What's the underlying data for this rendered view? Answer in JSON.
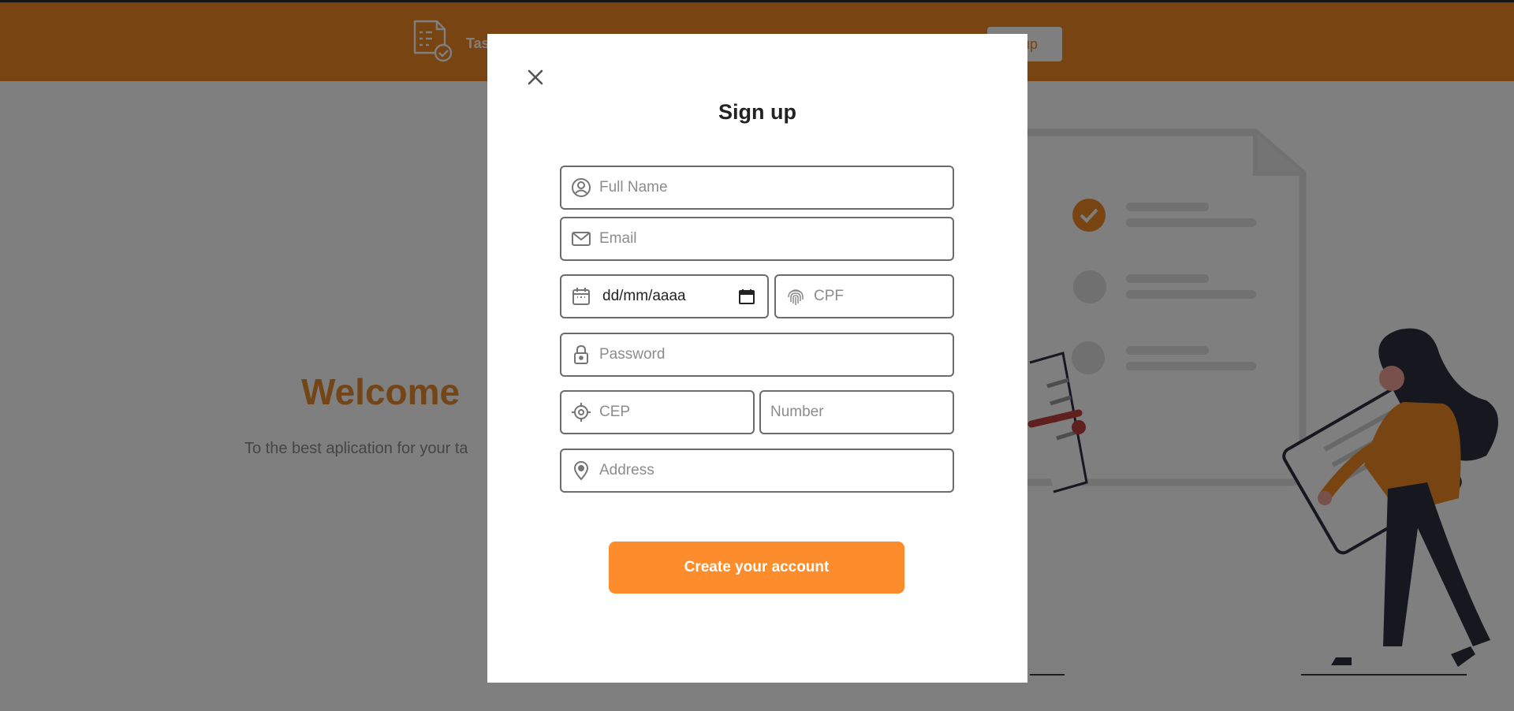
{
  "header": {
    "brand_name": "Tas",
    "signup_label": "up"
  },
  "hero": {
    "title": "Welcome",
    "subtitle": "To the best aplication for your ta"
  },
  "modal": {
    "title": "Sign up",
    "fields": {
      "full_name": {
        "placeholder": "Full Name",
        "icon": "user-circle-icon"
      },
      "email": {
        "placeholder": "Email",
        "icon": "envelope-icon"
      },
      "birth_date": {
        "value": "dd/mm/aaaa",
        "icon": "calendar-icon"
      },
      "cpf": {
        "placeholder": "CPF",
        "icon": "fingerprint-icon"
      },
      "password": {
        "placeholder": "Password",
        "icon": "lock-icon"
      },
      "cep": {
        "placeholder": "CEP",
        "icon": "crosshair-icon"
      },
      "number": {
        "placeholder": "Number"
      },
      "address": {
        "placeholder": "Address",
        "icon": "map-pin-icon"
      }
    },
    "submit_label": "Create your account"
  },
  "colors": {
    "accent": "#fd8d2c",
    "header": "#f08a24",
    "overlay": "rgba(0,0,0,0.5)",
    "dark": "#1d1d2b"
  }
}
